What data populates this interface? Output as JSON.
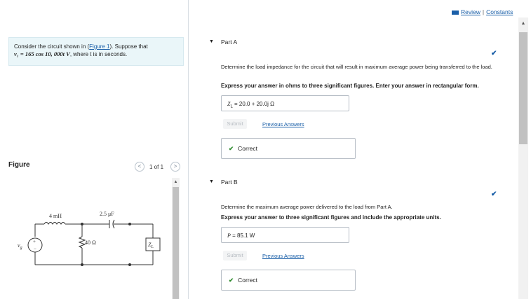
{
  "top_links": {
    "review": "Review",
    "separator": "|",
    "constants": "Constants"
  },
  "intro": {
    "text_before_link": "Consider the circuit shown in (",
    "link": "Figure 1",
    "text_after_link": "). Suppose that",
    "equation": "v₁ = 165 cos 10, 000t V",
    "text_end": ", where t is in seconds."
  },
  "figure": {
    "label": "Figure",
    "prev_icon": "chevron-left-icon",
    "next_icon": "chevron-right-icon",
    "pager": "1 of 1",
    "prev_glyph": "<",
    "next_glyph": ">",
    "components": {
      "inductor": "4 mH",
      "capacitor": "2.5 μF",
      "resistor": "40 Ω",
      "load": "Z_L",
      "source": "v_g"
    }
  },
  "part_a": {
    "title": "Part A",
    "question": "Determine the load impedance for the circuit that will result in maximum average power being transferred to the load.",
    "instruction": "Express your answer in ohms to three significant figures. Enter your answer in rectangular form.",
    "answer_var": "Z",
    "answer_sub": "L",
    "answer_value": " = 20.0 + 20.0j Ω",
    "submit": "Submit",
    "previous_answers": "Previous Answers",
    "result": "Correct",
    "check_glyph": "✔"
  },
  "part_b": {
    "title": "Part B",
    "question": "Determine the maximum average power delivered to the load from Part A.",
    "instruction": "Express your answer to three significant figures and include the appropriate units.",
    "answer_var": "P",
    "answer_value": " = 85.1 W",
    "submit": "Submit",
    "previous_answers": "Previous Answers",
    "result": "Correct",
    "check_glyph": "✔"
  },
  "colors": {
    "link": "#1a5fa8",
    "correct": "#2e8b2e",
    "intro_bg": "#eaf6f9"
  }
}
